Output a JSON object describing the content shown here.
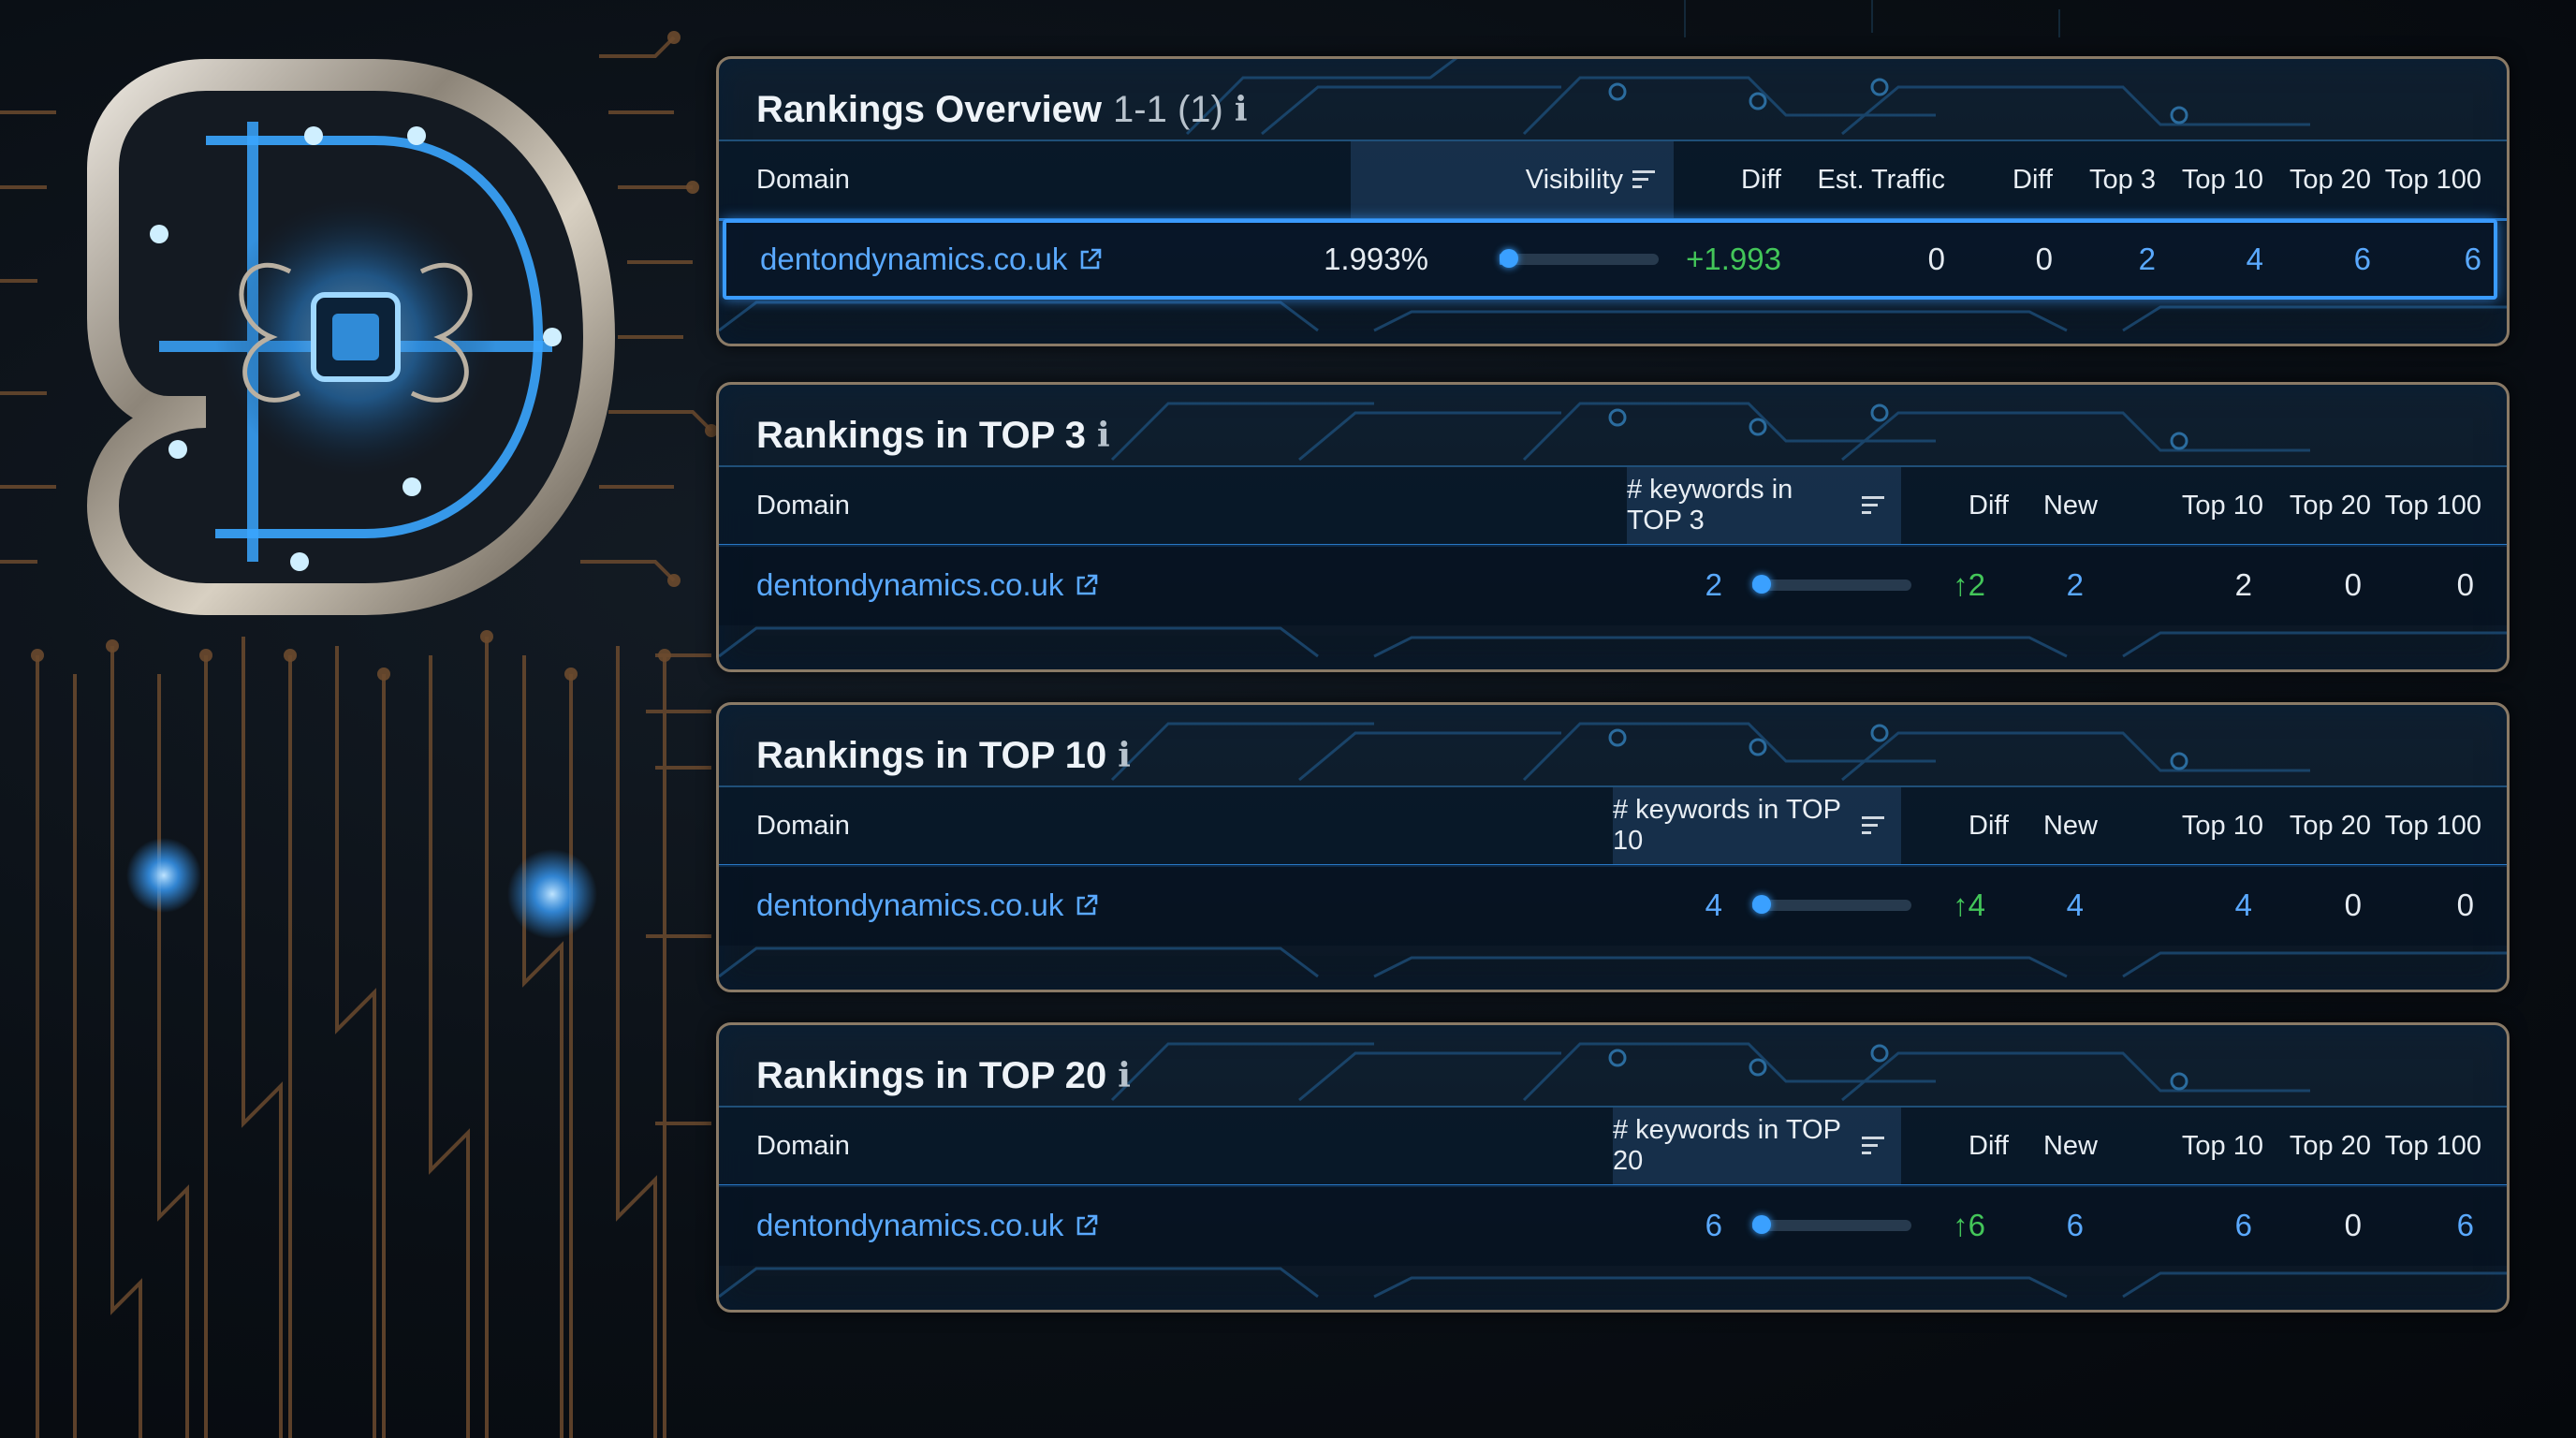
{
  "overview": {
    "title": "Rankings Overview",
    "range": "1-1 (1)",
    "info_icon": "info-icon",
    "columns": [
      "Domain",
      "Visibility",
      "Diff",
      "Est. Traffic",
      "Diff",
      "Top 3",
      "Top 10",
      "Top 20",
      "Top 100"
    ],
    "row": {
      "domain": "dentondynamics.co.uk",
      "visibility": "1.993%",
      "visibility_level": 0.02,
      "diff": "+1.993",
      "est_traffic": "0",
      "traffic_diff": "0",
      "top3": "2",
      "top10": "4",
      "top20": "6",
      "top100": "6"
    }
  },
  "top3": {
    "title": "Rankings in TOP 3",
    "columns": [
      "Domain",
      "# keywords in TOP 3",
      "Diff",
      "New",
      "Top 10",
      "Top 20",
      "Top 100"
    ],
    "row": {
      "domain": "dentondynamics.co.uk",
      "keywords": "2",
      "keywords_level": 0.05,
      "diff": "↑2",
      "new": "2",
      "top10": "2",
      "top20": "0",
      "top100": "0"
    }
  },
  "top10": {
    "title": "Rankings in TOP 10",
    "columns": [
      "Domain",
      "# keywords in TOP 10",
      "Diff",
      "New",
      "Top 10",
      "Top 20",
      "Top 100"
    ],
    "row": {
      "domain": "dentondynamics.co.uk",
      "keywords": "4",
      "keywords_level": 0.05,
      "diff": "↑4",
      "new": "4",
      "top10": "4",
      "top20": "0",
      "top100": "0"
    }
  },
  "top20": {
    "title": "Rankings in TOP 20",
    "columns": [
      "Domain",
      "# keywords in TOP 20",
      "Diff",
      "New",
      "Top 10",
      "Top 20",
      "Top 100"
    ],
    "row": {
      "domain": "dentondynamics.co.uk",
      "keywords": "6",
      "keywords_level": 0.05,
      "diff": "↑6",
      "new": "6",
      "top10": "6",
      "top20": "0",
      "top100": "6"
    }
  },
  "icons": {
    "external": "external-link-icon",
    "sort": "sort-descending-icon",
    "info": "info-icon",
    "logo": "d-monogram-logo"
  },
  "colors": {
    "link": "#5aa9ff",
    "positive": "#43c659",
    "selected_border": "#3a9bff",
    "panel_border": "#8a7a66"
  }
}
